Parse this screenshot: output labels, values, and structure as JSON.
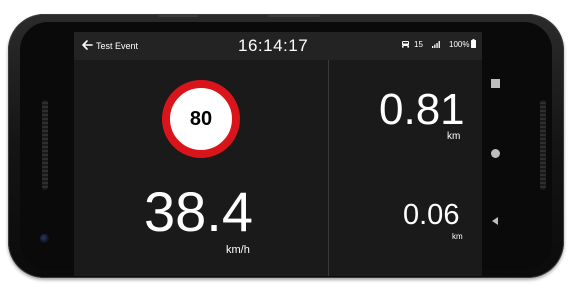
{
  "header": {
    "back_label": "Test Event",
    "clock": "16:14:17"
  },
  "status": {
    "satellites": "15",
    "battery": "100%"
  },
  "speed_limit": {
    "value": "80",
    "ring_color": "#d9151b"
  },
  "speed": {
    "value": "38.4",
    "unit": "km/h"
  },
  "distance_primary": {
    "value": "0.81",
    "unit": "km"
  },
  "distance_secondary": {
    "value": "0.06",
    "unit": "km"
  },
  "icons": {
    "back": "arrow-left-icon",
    "satellites": "car-icon",
    "signal": "signal-icon",
    "battery": "battery-icon",
    "recents": "square-icon",
    "home": "circle-icon",
    "nav_back": "triangle-left-icon"
  },
  "colors": {
    "screen_bg": "#1a1a1a",
    "statusbar_bg": "#232323",
    "text": "#ffffff"
  }
}
